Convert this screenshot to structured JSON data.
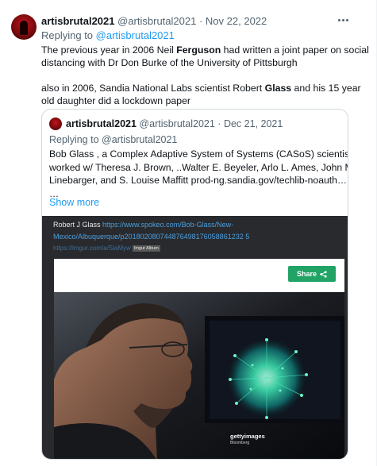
{
  "tweet": {
    "display_name": "artisbrutal2021",
    "handle": "@artisbrutal2021",
    "separator": "·",
    "date": "Nov 22, 2022",
    "replying_prefix": "Replying to",
    "replying_to": "@artisbrutal2021",
    "lines": [
      [
        "The previous year in 2006 Neil ",
        "Ferguson",
        " had written a joint paper on social"
      ],
      [
        "distancing with Dr Don Burke of the University of Pittsburgh",
        "",
        ""
      ],
      [
        "",
        "",
        ""
      ],
      [
        " also in 2006, Sandia National Labs scientist Robert ",
        "Glass",
        " and his 15 year"
      ],
      [
        "old daughter did a lockdown paper",
        "",
        ""
      ]
    ]
  },
  "quote": {
    "display_name": "artisbrutal2021",
    "handle": "@artisbrutal2021",
    "separator": "·",
    "date": "Dec 21, 2021",
    "replying": "Replying to @artisbrutal2021",
    "lines": [
      "Bob Glass , a Complex Adaptive System of Systems (CASoS) scientist",
      "worked w/ Theresa J. Brown, ..Walter E. Beyeler, Arlo L. Ames, John M.",
      "Linebarger, and S. Louise Maffitt prod-ng.sandia.gov/techlib-noauth…",
      "…"
    ],
    "show_more": "Show more",
    "media": {
      "caption_name": "Robert J Glass ",
      "caption_url_1": "https://www.spokeo.com/Bob-Glass/New-",
      "caption_url_2": "Mexico/Albuquerque/p201802080744876498176058861232 5",
      "imgur_link": "https://imgur.com/a/SiaMyw",
      "imgur_tag": "Imgur Album",
      "share_label": "Share",
      "watermark_brand": "gettyimages",
      "watermark_credit": "Bloomberg"
    }
  },
  "colors": {
    "link": "#1d9bf0",
    "secondary_text": "#536471",
    "share_green": "#21a366",
    "media_bg": "#292a2d"
  }
}
